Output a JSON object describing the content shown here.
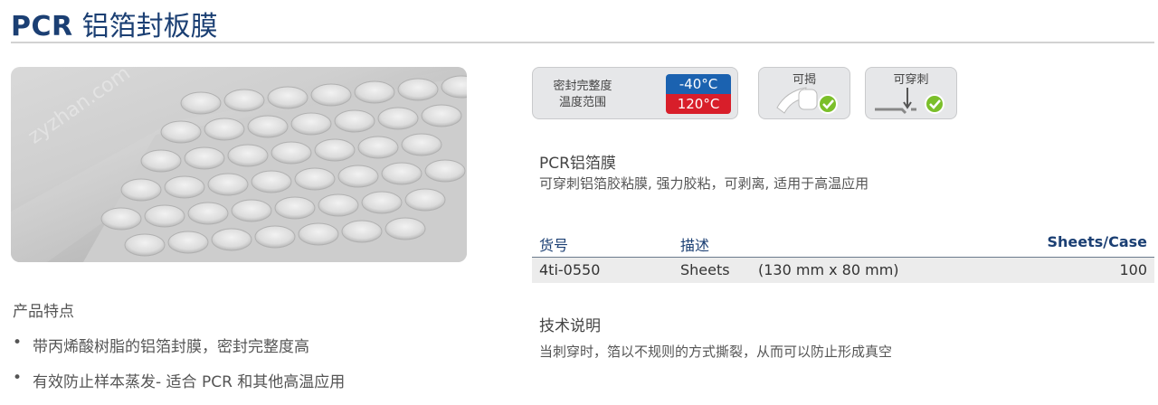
{
  "header": {
    "title_en": "PCR",
    "title_cn": "铝箔封板膜"
  },
  "badges": {
    "temp": {
      "label_line1": "密封完整度",
      "label_line2": "温度范围",
      "low": "-40°C",
      "high": "120°C"
    },
    "peelable": {
      "label": "可揭",
      "icon": "peel-check-icon"
    },
    "pierceable": {
      "label": "可穿刺",
      "icon": "pierce-check-icon"
    }
  },
  "product": {
    "name": "PCR铝箔膜",
    "description": "可穿刺铝箔胶粘膜, 强力胶粘，可剥离, 适用于高温应用"
  },
  "table": {
    "headers": [
      "货号",
      "描述",
      "Sheets/Case"
    ],
    "rows": [
      {
        "code": "4ti-0550",
        "desc": "Sheets",
        "size": "(130 mm x 80 mm)",
        "qty": "100"
      }
    ]
  },
  "tech": {
    "title": "技术说明",
    "text": "当刺穿时，箔以不规则的方式撕裂，从而可以防止形成真空"
  },
  "features": {
    "title": "产品特点",
    "items": [
      "带丙烯酸树脂的铝箔封膜，密封完整度高",
      "有效防止样本蒸发- 适合 PCR 和其他高温应用"
    ]
  },
  "colors": {
    "brand": "#1b3f73",
    "cold": "#1b62b0",
    "hot": "#d81e2a",
    "check": "#7bbf2a"
  },
  "watermark": "zyzhan.com"
}
